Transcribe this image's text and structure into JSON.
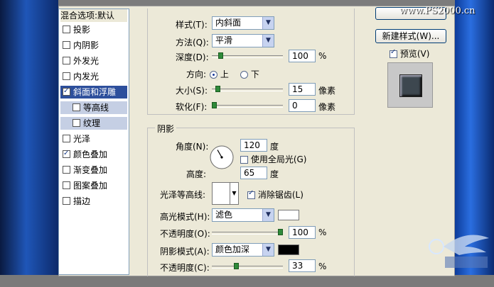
{
  "watermark": "www.PS2000.cn",
  "styles_list": {
    "header": "混合选项:默认",
    "items": [
      {
        "label": "投影",
        "checked": false
      },
      {
        "label": "内阴影",
        "checked": false
      },
      {
        "label": "外发光",
        "checked": false
      },
      {
        "label": "内发光",
        "checked": false
      },
      {
        "label": "斜面和浮雕",
        "checked": true,
        "selected": true
      },
      {
        "label": "等高线",
        "checked": false,
        "sub": true
      },
      {
        "label": "纹理",
        "checked": false,
        "sub": true
      },
      {
        "label": "光泽",
        "checked": false
      },
      {
        "label": "颜色叠加",
        "checked": true
      },
      {
        "label": "渐变叠加",
        "checked": false
      },
      {
        "label": "图案叠加",
        "checked": false
      },
      {
        "label": "描边",
        "checked": false
      }
    ]
  },
  "structure": {
    "style_label": "样式(T):",
    "style_value": "内斜面",
    "method_label": "方法(Q):",
    "method_value": "平滑",
    "depth_label": "深度(D):",
    "depth_value": "100",
    "depth_fraction": 0.1,
    "percent": "%",
    "direction_label": "方向:",
    "direction_up": "上",
    "direction_down": "下",
    "size_label": "大小(S):",
    "size_value": "15",
    "size_fraction": 0.05,
    "soften_label": "软化(F):",
    "soften_value": "0",
    "soften_fraction": 0.0,
    "px_unit": "像素"
  },
  "shading": {
    "title": "阴影",
    "angle_label": "角度(N):",
    "angle_value": "120",
    "degree": "度",
    "global_light_label": "使用全局光(G)",
    "altitude_label": "高度:",
    "altitude_value": "65",
    "gloss_label": "光泽等高线:",
    "antialias_label": "消除锯齿(L)",
    "highlight_mode_label": "高光模式(H):",
    "highlight_mode_value": "滤色",
    "highlight_color": "#ffffff",
    "opacity1_label": "不透明度(O):",
    "opacity1_value": "100",
    "opacity1_fraction": 1.0,
    "shadow_mode_label": "阴影模式(A):",
    "shadow_mode_value": "颜色加深",
    "shadow_color": "#000000",
    "opacity2_label": "不透明度(C):",
    "opacity2_value": "33",
    "opacity2_fraction": 0.33
  },
  "right_panel": {
    "new_style_button": "新建样式(W)...",
    "preview_label": "预览(V)",
    "preview_checked": true
  }
}
